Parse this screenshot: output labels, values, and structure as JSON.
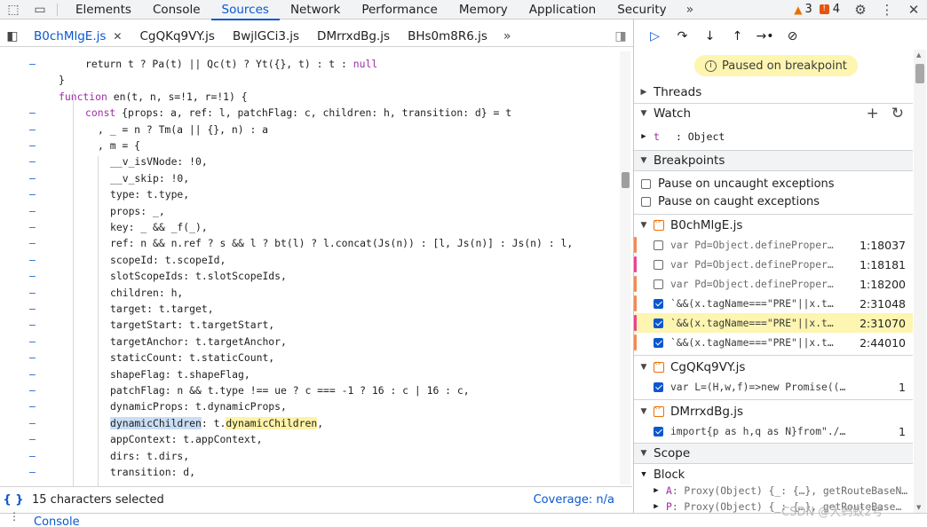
{
  "toolbar": {
    "tabs": [
      {
        "label": "Elements"
      },
      {
        "label": "Console"
      },
      {
        "label": "Sources"
      },
      {
        "label": "Network"
      },
      {
        "label": "Performance"
      },
      {
        "label": "Memory"
      },
      {
        "label": "Application"
      },
      {
        "label": "Security"
      }
    ],
    "warnings_count": "3",
    "errors_count": "4"
  },
  "file_tabs": [
    {
      "label": "B0chMlgE.js"
    },
    {
      "label": "CgQKq9VY.js"
    },
    {
      "label": "BwjlGCi3.js"
    },
    {
      "label": "DMrrxdBg.js"
    },
    {
      "label": "BHs0m8R6.js"
    }
  ],
  "editor": {
    "status_selected": "15 characters selected",
    "coverage": "Coverage: n/a",
    "gutter_mark": "–",
    "lines": [
      [
        "return t ? Pa(t) || Qc(t) ? Yt({}, t) : t : ",
        "null"
      ],
      [
        "}"
      ],
      [
        "function",
        " en(t, n, s=!1, r=!1) {"
      ],
      [
        "const",
        " {props: a, ref: l, patchFlag: c, children: h, transition: d} = t"
      ],
      [
        ", _ = n ? Tm(a || {}, n) : a"
      ],
      [
        ", m = {"
      ],
      [
        "__v_isVNode: !0,"
      ],
      [
        "__v_skip: !0,"
      ],
      [
        "type: t.type,"
      ],
      [
        "props: _,"
      ],
      [
        "key: _ && _f(_),"
      ],
      [
        "ref: n && n.ref ? s && l ? bt(l) ? l.concat(Js(n)) : [l, Js(n)] : Js(n) : l,"
      ],
      [
        "scopeId: t.scopeId,"
      ],
      [
        "slotScopeIds: t.slotScopeIds,"
      ],
      [
        "children: h,"
      ],
      [
        "target: t.target,"
      ],
      [
        "targetStart: t.targetStart,"
      ],
      [
        "targetAnchor: t.targetAnchor,"
      ],
      [
        "staticCount: t.staticCount,"
      ],
      [
        "shapeFlag: t.shapeFlag,"
      ],
      [
        "patchFlag: n && t.type !== ue ? c === -1 ? 16 : c | 16 : c,"
      ],
      [
        "dynamicProps: t.dynamicProps,"
      ],
      [
        "dynamicChildren",
        ": t.",
        "dynamicChildren",
        ","
      ],
      [
        "appContext: t.appContext,"
      ],
      [
        "dirs: t.dirs,"
      ],
      [
        "transition: d,"
      ]
    ]
  },
  "debugger": {
    "paused_text": "Paused on breakpoint",
    "threads_label": "Threads",
    "watch_label": "Watch",
    "watch_item": {
      "name": "t",
      "value": ": Object"
    },
    "breakpoints_label": "Breakpoints",
    "pause_uncaught": "Pause on uncaught exceptions",
    "pause_caught": "Pause on caught exceptions",
    "files": [
      {
        "name": "B0chMlgE.js",
        "items": [
          {
            "code": "var Pd=Object.defineProper…",
            "loc": "1:18037",
            "checked": false,
            "color": "#f28b54"
          },
          {
            "code": "var Pd=Object.defineProper…",
            "loc": "1:18181",
            "checked": false,
            "color": "#e8458f"
          },
          {
            "code": "var Pd=Object.defineProper…",
            "loc": "1:18200",
            "checked": false,
            "color": "#f28b54"
          },
          {
            "code": "`&&(x.tagName===\"PRE\"||x.t…",
            "loc": "2:31048",
            "checked": true,
            "color": "#f28b54"
          },
          {
            "code": "`&&(x.tagName===\"PRE\"||x.t…",
            "loc": "2:31070",
            "checked": true,
            "color": "#e8458f"
          },
          {
            "code": "`&&(x.tagName===\"PRE\"||x.t…",
            "loc": "2:44010",
            "checked": true,
            "color": "#f28b54"
          }
        ]
      },
      {
        "name": "CgQKq9VY.js",
        "items": [
          {
            "code": "var L=(H,w,f)=>new Promise((j,y…",
            "loc": "1",
            "checked": true,
            "color": ""
          }
        ]
      },
      {
        "name": "DMrrxdBg.js",
        "items": [
          {
            "code": "import{p as h,q as N}from\"./B0c…",
            "loc": "1",
            "checked": true,
            "color": ""
          }
        ]
      }
    ],
    "scope_label": "Scope",
    "block_label": "Block",
    "scope_items": [
      {
        "key": "A",
        "value": ": Proxy(Object)  {_: {…}, getRouteBaseN…"
      },
      {
        "key": "P",
        "value": ": Proxy(Object)  {_: {…}, getRouteBase…"
      }
    ]
  },
  "drawer": {
    "tab": "Console"
  },
  "watermark": "CSDN @大蚂蚁2号"
}
